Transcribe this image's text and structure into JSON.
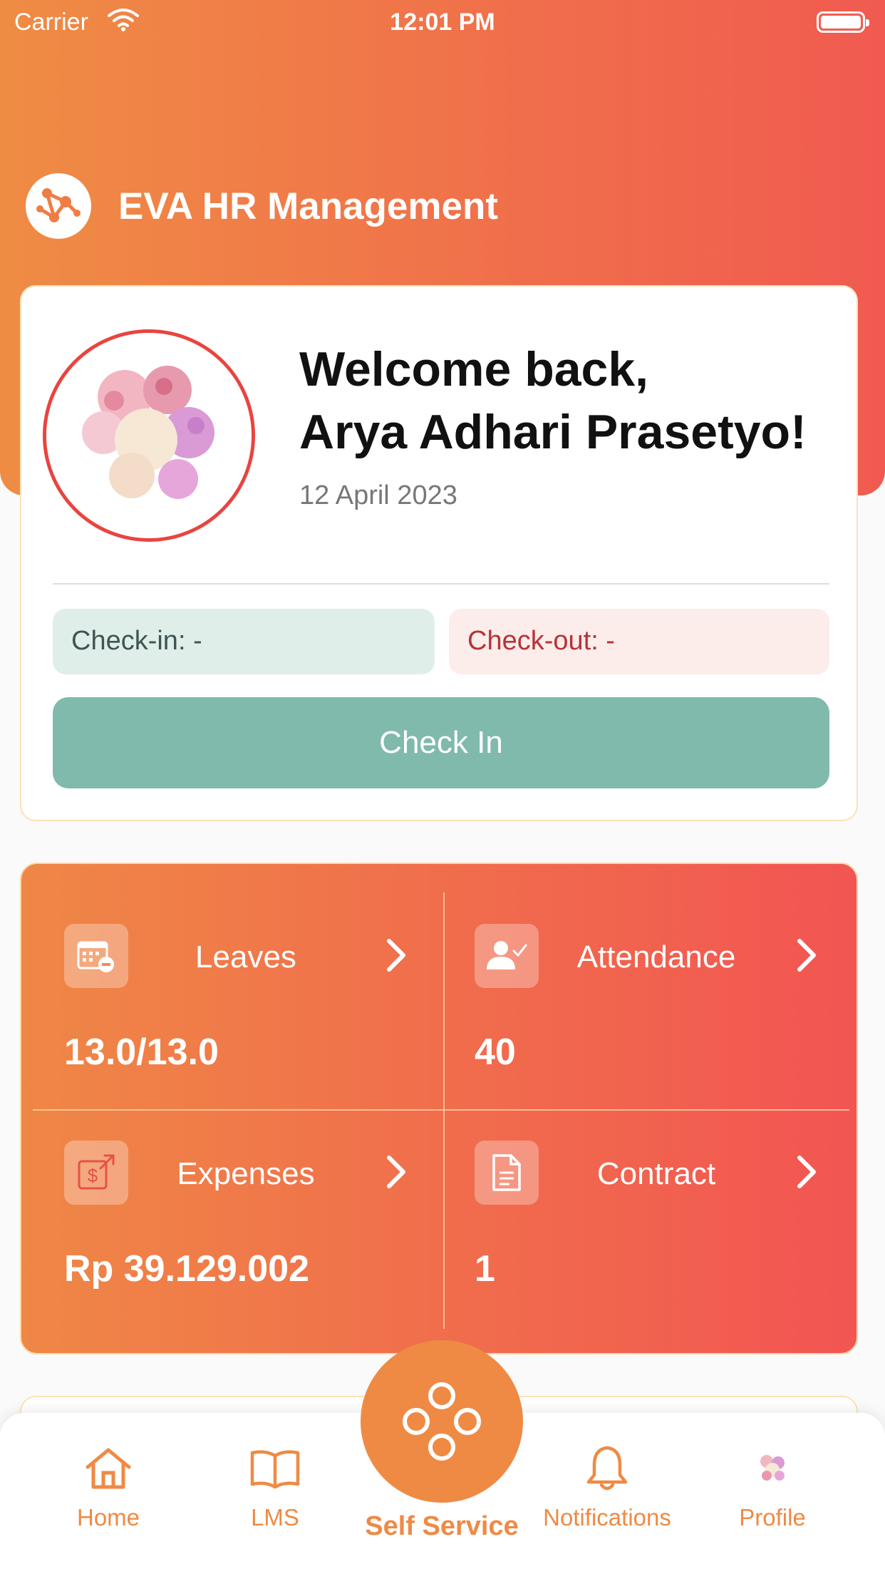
{
  "status_bar": {
    "carrier": "Carrier",
    "time": "12:01 PM"
  },
  "header": {
    "title": "EVA HR Management",
    "logo_icon": "network-logo-icon"
  },
  "profile_card": {
    "welcome_line1": "Welcome back,",
    "welcome_line2": "Arya Adhari Prasetyo!",
    "date": "12 April 2023",
    "check_in": "Check-in: -",
    "check_out": "Check-out: -",
    "check_in_button": "Check In"
  },
  "stats": [
    {
      "label": "Leaves",
      "value": "13.0/13.0",
      "icon": "calendar-minus-icon"
    },
    {
      "label": "Attendance",
      "value": "40",
      "icon": "user-check-icon"
    },
    {
      "label": "Expenses",
      "value": "Rp 39.129.002",
      "icon": "dollar-export-icon"
    },
    {
      "label": "Contract",
      "value": "1",
      "icon": "document-icon"
    }
  ],
  "tabbar": {
    "home": "Home",
    "lms": "LMS",
    "self_service": "Self Service",
    "notifications": "Notifications",
    "profile": "Profile"
  },
  "colors": {
    "accent": "#ef8a44",
    "gradient_end": "#f15a50",
    "check_in_button": "#7fbaad",
    "check_out_text": "#b5343a"
  }
}
